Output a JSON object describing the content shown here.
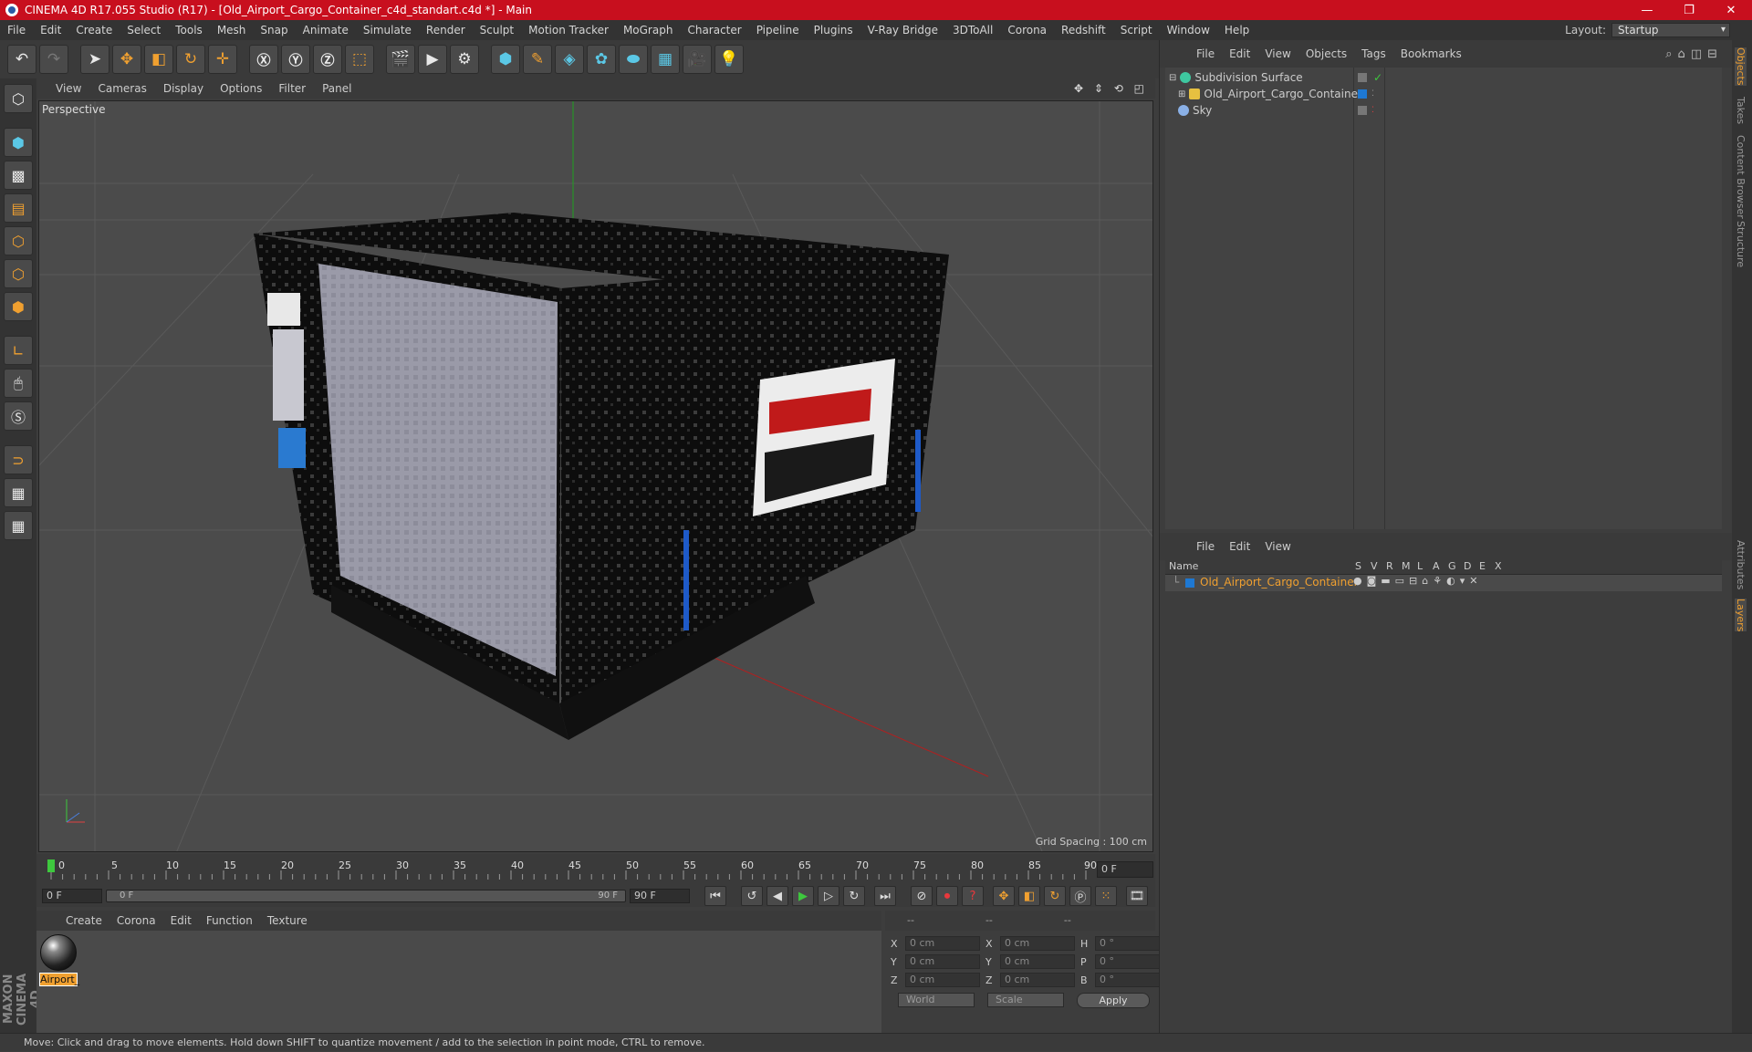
{
  "window": {
    "title": "CINEMA 4D R17.055 Studio (R17) - [Old_Airport_Cargo_Container_c4d_standart.c4d *] - Main",
    "buttons": [
      "—",
      "❐",
      "✕"
    ]
  },
  "menubar": {
    "items": [
      "File",
      "Edit",
      "Create",
      "Select",
      "Tools",
      "Mesh",
      "Snap",
      "Animate",
      "Simulate",
      "Render",
      "Sculpt",
      "Motion Tracker",
      "MoGraph",
      "Character",
      "Pipeline",
      "Plugins",
      "V-Ray Bridge",
      "3DToAll",
      "Corona",
      "Redshift",
      "Script",
      "Window",
      "Help"
    ],
    "layout_label": "Layout:",
    "layout_value": "Startup"
  },
  "viewport": {
    "menu": [
      "View",
      "Cameras",
      "Display",
      "Options",
      "Filter",
      "Panel"
    ],
    "label": "Perspective",
    "grid_spacing": "Grid Spacing : 100 cm",
    "nav_icons": "✥ ⇕ ⟲ ◰"
  },
  "timeline": {
    "ticks": [
      "0",
      "5",
      "10",
      "15",
      "20",
      "25",
      "30",
      "35",
      "40",
      "45",
      "50",
      "55",
      "60",
      "65",
      "70",
      "75",
      "80",
      "85",
      "90"
    ],
    "current_frame": "0 F"
  },
  "playbar": {
    "start": "0 F",
    "slider_start": "0 F",
    "slider_end": "90 F",
    "end": "90 F"
  },
  "material_manager": {
    "menu": [
      "Create",
      "Corona",
      "Edit",
      "Function",
      "Texture"
    ],
    "materials": [
      {
        "name": "Airport_"
      }
    ]
  },
  "coordinates": {
    "header": [
      "--",
      "--",
      "--"
    ],
    "rows": [
      {
        "a1": "X",
        "v1": "0 cm",
        "a2": "X",
        "v2": "0 cm",
        "a3": "H",
        "v3": "0 °"
      },
      {
        "a1": "Y",
        "v1": "0 cm",
        "a2": "Y",
        "v2": "0 cm",
        "a3": "P",
        "v3": "0 °"
      },
      {
        "a1": "Z",
        "v1": "0 cm",
        "a2": "Z",
        "v2": "0 cm",
        "a3": "B",
        "v3": "0 °"
      }
    ],
    "space": "World",
    "mode": "Scale",
    "apply": "Apply"
  },
  "object_manager": {
    "menu": [
      "File",
      "Edit",
      "View",
      "Objects",
      "Tags",
      "Bookmarks"
    ],
    "objects": [
      {
        "name": "Subdivision Surface",
        "icon_color": "#3ec8a0"
      },
      {
        "name": "Old_Airport_Cargo_Container",
        "icon_color": "#e6c040"
      },
      {
        "name": "Sky",
        "icon_color": "#8ab0e6"
      }
    ]
  },
  "layer_manager": {
    "menu": [
      "File",
      "Edit",
      "View"
    ],
    "columns": [
      "Name",
      "S",
      "V",
      "R",
      "M",
      "L",
      "A",
      "G",
      "D",
      "E",
      "X"
    ],
    "layers": [
      {
        "name": "Old_Airport_Cargo_Container",
        "color": "#1e78d2"
      }
    ]
  },
  "right_tabs": [
    "Objects",
    "Takes",
    "Content Browser",
    "Structure",
    "Attributes",
    "Layers"
  ],
  "maxon_logo": "MAXON CINEMA 4D",
  "status": "Move: Click and drag to move elements. Hold down SHIFT to quantize movement / add to the selection in point mode, CTRL to remove.",
  "colors": {
    "accent": "#f0a030",
    "titlebar": "#c80f1e"
  }
}
